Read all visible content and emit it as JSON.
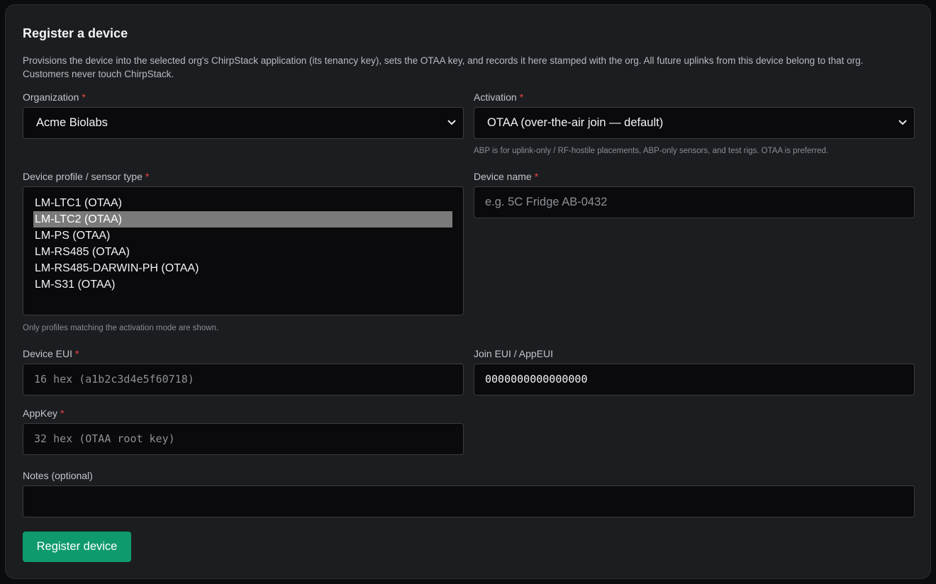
{
  "form": {
    "title": "Register a device",
    "description": "Provisions the device into the selected org's ChirpStack application (its tenancy key), sets the OTAA key, and records it here stamped with the org. All future uplinks from this device belong to that org. Customers never touch ChirpStack.",
    "required_marker": "*"
  },
  "organization": {
    "label": "Organization",
    "selected": "Acme Biolabs"
  },
  "activation": {
    "label": "Activation",
    "selected": "OTAA (over-the-air join — default)",
    "hint": "ABP is for uplink-only / RF-hostile placements, ABP-only sensors, and test rigs. OTAA is preferred."
  },
  "device_profile": {
    "label": "Device profile / sensor type",
    "options": [
      "LM-LTC1 (OTAA)",
      "LM-LTC2 (OTAA)",
      "LM-PS (OTAA)",
      "LM-RS485 (OTAA)",
      "LM-RS485-DARWIN-PH (OTAA)",
      "LM-S31 (OTAA)"
    ],
    "selected_index": 1,
    "hint": "Only profiles matching the activation mode are shown."
  },
  "device_name": {
    "label": "Device name",
    "placeholder": "e.g. 5C Fridge AB-0432",
    "value": ""
  },
  "device_eui": {
    "label": "Device EUI",
    "placeholder": "16 hex (a1b2c3d4e5f60718)",
    "value": ""
  },
  "join_eui": {
    "label": "Join EUI / AppEUI",
    "value": "0000000000000000"
  },
  "app_key": {
    "label": "AppKey",
    "placeholder": "32 hex (OTAA root key)",
    "value": ""
  },
  "notes": {
    "label": "Notes (optional)",
    "value": ""
  },
  "submit": {
    "label": "Register device"
  },
  "colors": {
    "accent": "#0e9a6e",
    "required": "#ef4444",
    "background": "#1c1d20"
  },
  "icons": {
    "select_arrow": "chevron-down-icon"
  }
}
